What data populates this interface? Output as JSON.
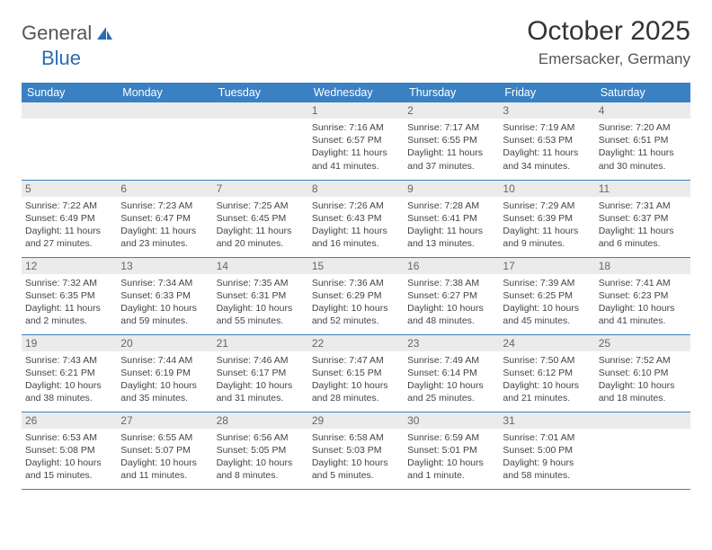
{
  "logo": {
    "part1": "General",
    "part2": "Blue"
  },
  "title": "October 2025",
  "location": "Emersacker, Germany",
  "day_headers": [
    "Sunday",
    "Monday",
    "Tuesday",
    "Wednesday",
    "Thursday",
    "Friday",
    "Saturday"
  ],
  "weeks": [
    [
      null,
      null,
      null,
      {
        "n": "1",
        "sr": "7:16 AM",
        "ss": "6:57 PM",
        "dl": "11 hours and 41 minutes."
      },
      {
        "n": "2",
        "sr": "7:17 AM",
        "ss": "6:55 PM",
        "dl": "11 hours and 37 minutes."
      },
      {
        "n": "3",
        "sr": "7:19 AM",
        "ss": "6:53 PM",
        "dl": "11 hours and 34 minutes."
      },
      {
        "n": "4",
        "sr": "7:20 AM",
        "ss": "6:51 PM",
        "dl": "11 hours and 30 minutes."
      }
    ],
    [
      {
        "n": "5",
        "sr": "7:22 AM",
        "ss": "6:49 PM",
        "dl": "11 hours and 27 minutes."
      },
      {
        "n": "6",
        "sr": "7:23 AM",
        "ss": "6:47 PM",
        "dl": "11 hours and 23 minutes."
      },
      {
        "n": "7",
        "sr": "7:25 AM",
        "ss": "6:45 PM",
        "dl": "11 hours and 20 minutes."
      },
      {
        "n": "8",
        "sr": "7:26 AM",
        "ss": "6:43 PM",
        "dl": "11 hours and 16 minutes."
      },
      {
        "n": "9",
        "sr": "7:28 AM",
        "ss": "6:41 PM",
        "dl": "11 hours and 13 minutes."
      },
      {
        "n": "10",
        "sr": "7:29 AM",
        "ss": "6:39 PM",
        "dl": "11 hours and 9 minutes."
      },
      {
        "n": "11",
        "sr": "7:31 AM",
        "ss": "6:37 PM",
        "dl": "11 hours and 6 minutes."
      }
    ],
    [
      {
        "n": "12",
        "sr": "7:32 AM",
        "ss": "6:35 PM",
        "dl": "11 hours and 2 minutes."
      },
      {
        "n": "13",
        "sr": "7:34 AM",
        "ss": "6:33 PM",
        "dl": "10 hours and 59 minutes."
      },
      {
        "n": "14",
        "sr": "7:35 AM",
        "ss": "6:31 PM",
        "dl": "10 hours and 55 minutes."
      },
      {
        "n": "15",
        "sr": "7:36 AM",
        "ss": "6:29 PM",
        "dl": "10 hours and 52 minutes."
      },
      {
        "n": "16",
        "sr": "7:38 AM",
        "ss": "6:27 PM",
        "dl": "10 hours and 48 minutes."
      },
      {
        "n": "17",
        "sr": "7:39 AM",
        "ss": "6:25 PM",
        "dl": "10 hours and 45 minutes."
      },
      {
        "n": "18",
        "sr": "7:41 AM",
        "ss": "6:23 PM",
        "dl": "10 hours and 41 minutes."
      }
    ],
    [
      {
        "n": "19",
        "sr": "7:43 AM",
        "ss": "6:21 PM",
        "dl": "10 hours and 38 minutes."
      },
      {
        "n": "20",
        "sr": "7:44 AM",
        "ss": "6:19 PM",
        "dl": "10 hours and 35 minutes."
      },
      {
        "n": "21",
        "sr": "7:46 AM",
        "ss": "6:17 PM",
        "dl": "10 hours and 31 minutes."
      },
      {
        "n": "22",
        "sr": "7:47 AM",
        "ss": "6:15 PM",
        "dl": "10 hours and 28 minutes."
      },
      {
        "n": "23",
        "sr": "7:49 AM",
        "ss": "6:14 PM",
        "dl": "10 hours and 25 minutes."
      },
      {
        "n": "24",
        "sr": "7:50 AM",
        "ss": "6:12 PM",
        "dl": "10 hours and 21 minutes."
      },
      {
        "n": "25",
        "sr": "7:52 AM",
        "ss": "6:10 PM",
        "dl": "10 hours and 18 minutes."
      }
    ],
    [
      {
        "n": "26",
        "sr": "6:53 AM",
        "ss": "5:08 PM",
        "dl": "10 hours and 15 minutes."
      },
      {
        "n": "27",
        "sr": "6:55 AM",
        "ss": "5:07 PM",
        "dl": "10 hours and 11 minutes."
      },
      {
        "n": "28",
        "sr": "6:56 AM",
        "ss": "5:05 PM",
        "dl": "10 hours and 8 minutes."
      },
      {
        "n": "29",
        "sr": "6:58 AM",
        "ss": "5:03 PM",
        "dl": "10 hours and 5 minutes."
      },
      {
        "n": "30",
        "sr": "6:59 AM",
        "ss": "5:01 PM",
        "dl": "10 hours and 1 minute."
      },
      {
        "n": "31",
        "sr": "7:01 AM",
        "ss": "5:00 PM",
        "dl": "9 hours and 58 minutes."
      },
      null
    ]
  ],
  "labels": {
    "sunrise": "Sunrise: ",
    "sunset": "Sunset: ",
    "daylight": "Daylight: "
  }
}
